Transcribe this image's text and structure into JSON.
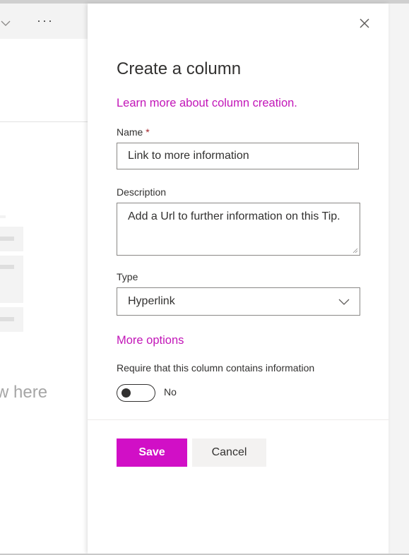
{
  "background": {
    "hint_text": "w here",
    "commandbar": {
      "chevron_icon": "chevron-down-icon",
      "more_icon": "more-icon",
      "more_glyph": "···"
    }
  },
  "panel": {
    "title": "Create a column",
    "close_icon": "close-icon",
    "learn_more_link": "Learn more about column creation.",
    "name": {
      "label": "Name",
      "required_mark": "*",
      "value": "Link to more information"
    },
    "description": {
      "label": "Description",
      "value": "Add a Url to further information on this Tip."
    },
    "type": {
      "label": "Type",
      "selected": "Hyperlink",
      "chevron_icon": "chevron-down-icon"
    },
    "more_options": "More options",
    "require": {
      "label": "Require that this column contains information",
      "toggle_state": "No"
    },
    "buttons": {
      "save": "Save",
      "cancel": "Cancel"
    },
    "colors": {
      "accent": "#d10fc6",
      "link": "#c216b8",
      "text": "#323130"
    }
  }
}
